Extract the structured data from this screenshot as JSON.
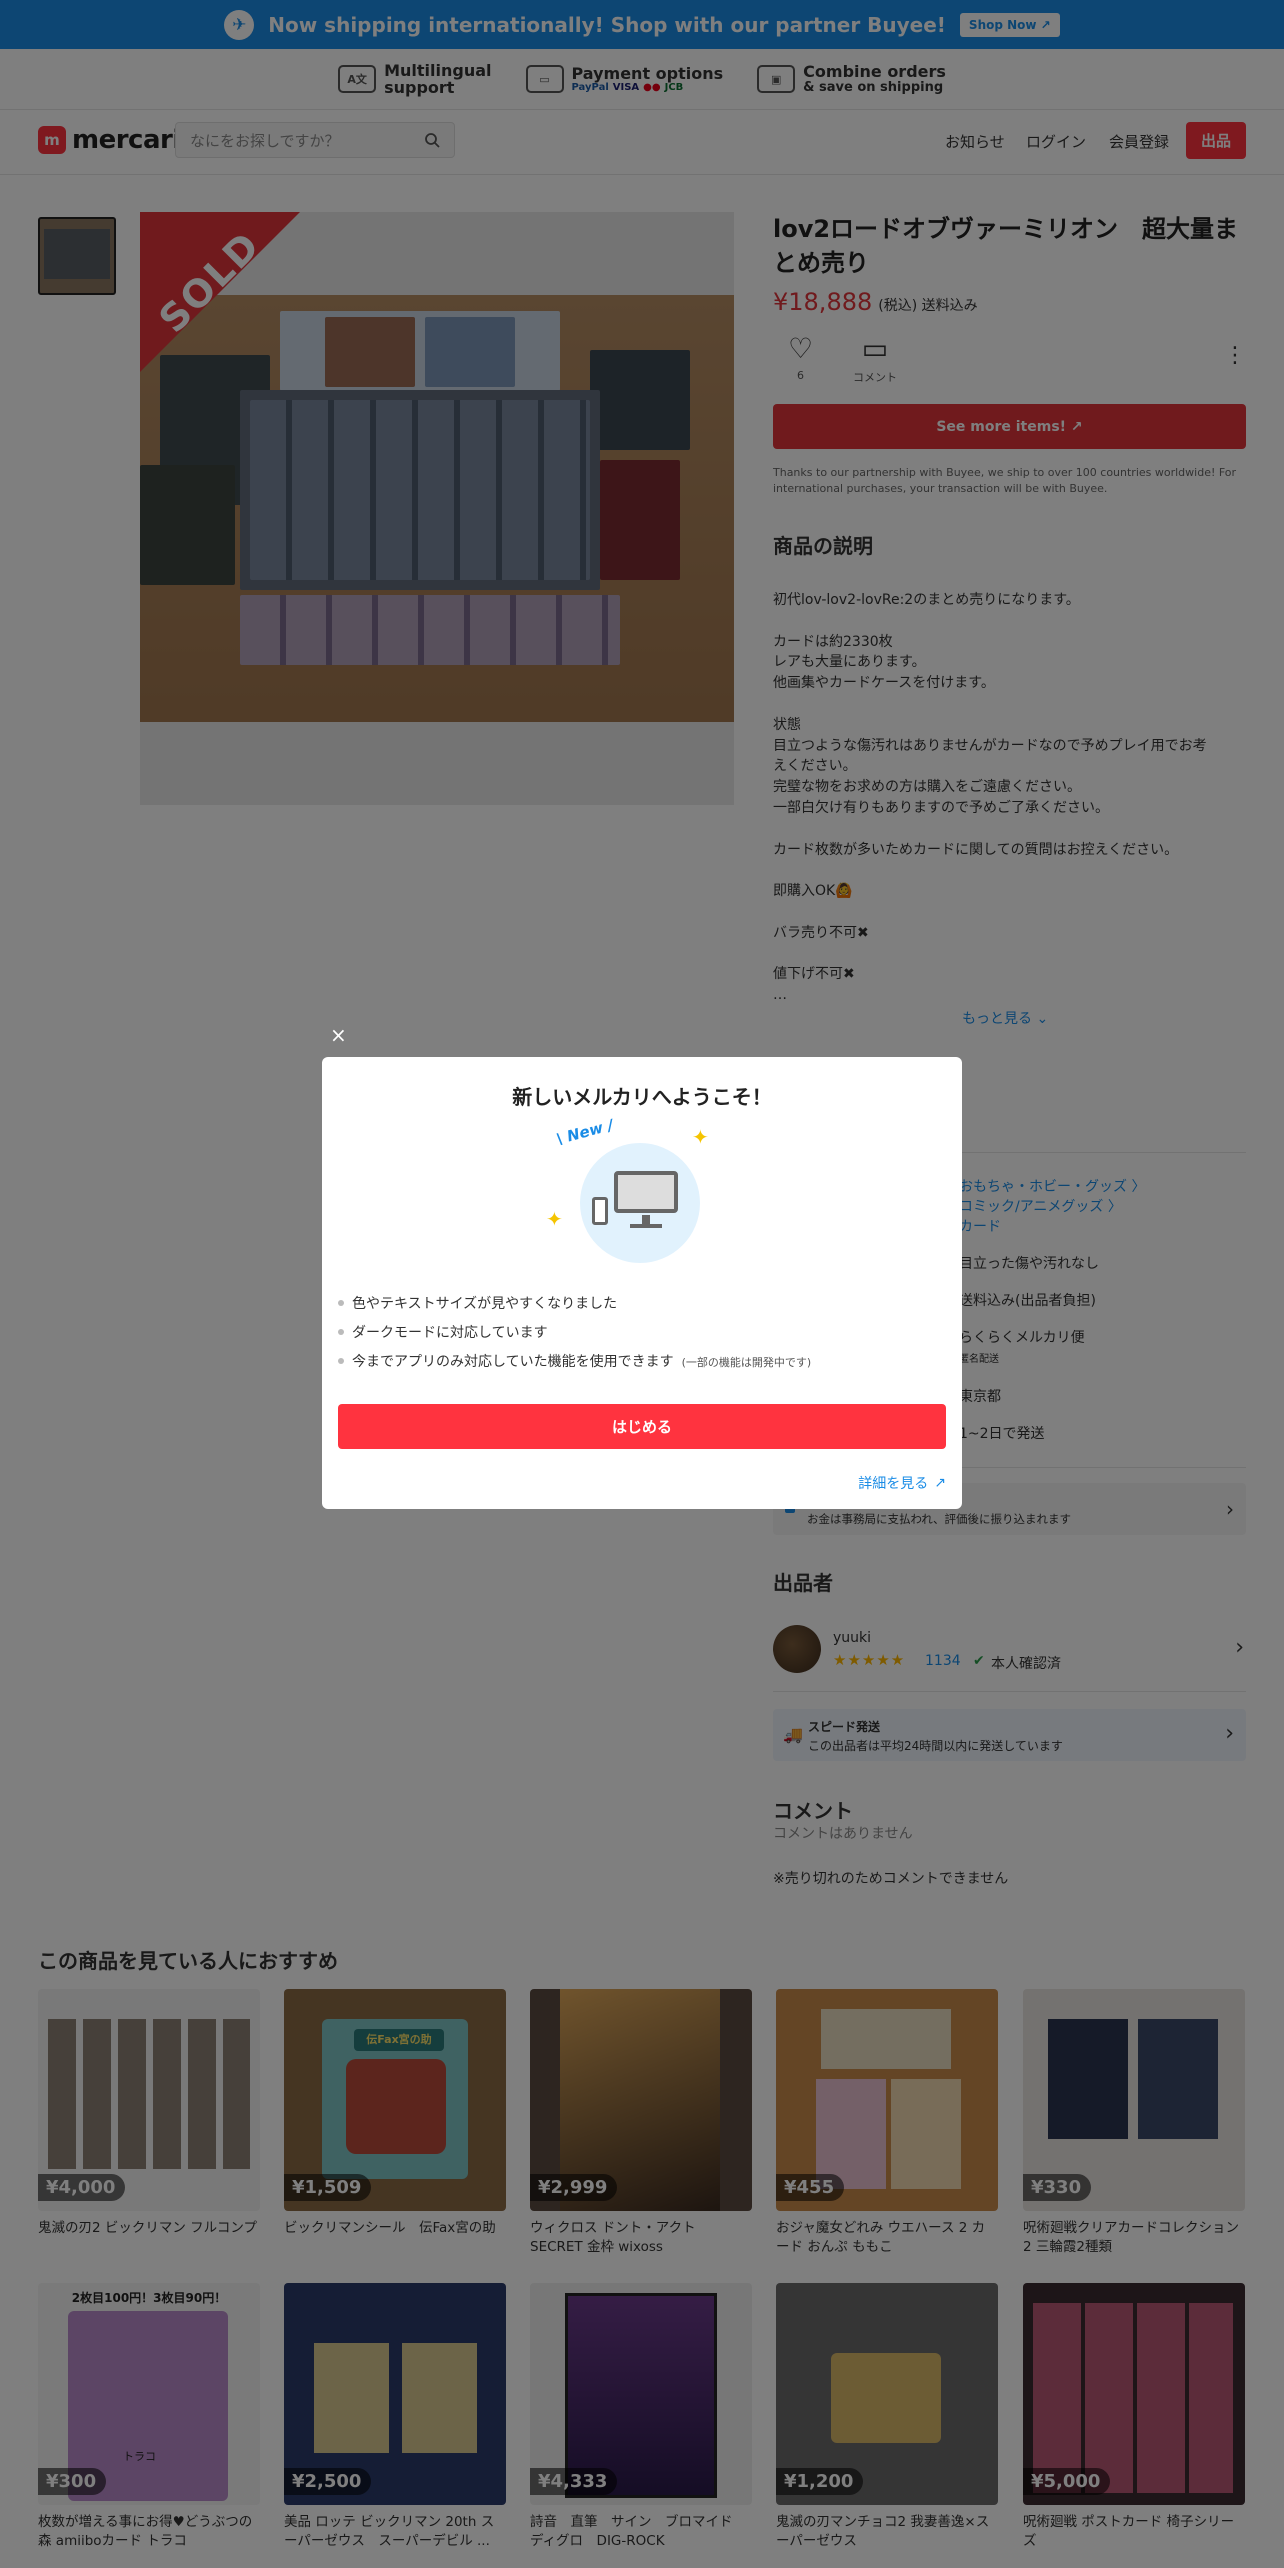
{
  "banner": {
    "text": "Now shipping internationally! Shop with our partner Buyee!",
    "button": "Shop Now",
    "icon": "airplane-icon"
  },
  "features": [
    {
      "title": "Multilingual",
      "subtitle": "support",
      "icon": "translate-icon",
      "icon_text": "A文"
    },
    {
      "title": "Payment options",
      "subtitle": "",
      "icon": "card-icon",
      "icon_text": "▭",
      "payments": [
        "PayPal",
        "VISA",
        "●●",
        "JCB"
      ]
    },
    {
      "title": "Combine orders",
      "subtitle": "& save on shipping",
      "icon": "box-icon",
      "icon_text": "▣"
    }
  ],
  "header": {
    "logo_text": "mercari",
    "logo_mark": "m",
    "search_placeholder": "なにをお探しですか？",
    "nav": {
      "news": "お知らせ",
      "login": "ログイン",
      "signup": "会員登録",
      "sell": "出品"
    }
  },
  "product": {
    "sold_label": "SOLD",
    "title": "lov2ロードオブヴァーミリオン　超大量まとめ売り",
    "price": "¥18,888",
    "price_note": "(税込) 送料込み",
    "likes_count": "6",
    "comment_label": "コメント",
    "see_more": "See more items!",
    "buyee_note": "Thanks to our partnership with Buyee, we ship to over 100 countries worldwide! For international purchases, your transaction will be with Buyee.",
    "desc_heading": "商品の説明",
    "desc_lines": [
      "初代lov-lov2-lovRe:2のまとめ売りになります。",
      "",
      "カードは約2330枚",
      "レアも大量にあります。",
      "他画集やカードケースを付けます。",
      "",
      "状態",
      "目立つような傷汚れはありませんがカードなので予めプレイ用でお考",
      "えください。",
      "完璧な物をお求めの方は購入をご遠慮ください。",
      "一部白欠け有りもありますので予めご了承ください。",
      "",
      "カード枚数が多いためカードに関しての質問はお控えください。",
      "",
      "即購入OK🙆",
      "",
      "バラ売り不可✖",
      "",
      "値下げ不可✖",
      "…"
    ],
    "more_link": "もっと見る"
  },
  "info_rows": [
    {
      "label": "",
      "value": "おもちゃ・ホビー・グッズ 〉",
      "link": true
    },
    {
      "label": "",
      "value": "コミック/アニメグッズ 〉",
      "link": true
    },
    {
      "label": "",
      "value": "カード",
      "link": true
    },
    {
      "label": "",
      "value": "目立った傷や汚れなし",
      "link": false
    },
    {
      "label": "",
      "value": "送料込み(出品者負担)",
      "link": false
    },
    {
      "label": "",
      "value": "らくらくメルカリ便",
      "link": false
    },
    {
      "label": "",
      "value": "匿名配送",
      "link": false
    },
    {
      "label": "",
      "value": "東京都",
      "link": false
    },
    {
      "label": "",
      "value": "1~2日で発送",
      "link": false
    }
  ],
  "payment_notice": "お金は事務局に支払われ、評価後に振り込まれます",
  "seller": {
    "heading": "出品者",
    "name": "yuuki",
    "stars": "★★★★★",
    "rating_count": "1134",
    "verified": "本人確認済"
  },
  "speed": {
    "title": "スピード発送",
    "text": "この出品者は平均24時間以内に発送しています"
  },
  "comments": {
    "heading": "コメント",
    "none": "コメントはありません",
    "closed": "※売り切れのためコメントできません"
  },
  "recommend": {
    "heading": "この商品を見ている人におすすめ",
    "items": [
      {
        "price": "¥4,000",
        "name": "鬼滅の刃2 ビックリマン フルコンプ"
      },
      {
        "price": "¥1,509",
        "name": "ビックリマンシール　伝Fax宮の助"
      },
      {
        "price": "¥2,999",
        "name": "ウィクロス ドント・アクト SECRET 金枠 wixoss"
      },
      {
        "price": "¥455",
        "name": "おジャ魔女どれみ ウエハース 2 カード おんぷ ももこ"
      },
      {
        "price": "¥330",
        "name": "呪術廻戦クリアカードコレクション2 三輪霞2種類"
      },
      {
        "price": "¥300",
        "name": "枚数が増える事にお得♥どうぶつの森 amiiboカード トラコ"
      },
      {
        "price": "¥2,500",
        "name": "美品 ロッテ ビックリマン 20th スーパーゼウス　スーパーデビル ..."
      },
      {
        "price": "¥4,333",
        "name": "詩音　直筆　サイン　ブロマイド　ディグロ　DIG-ROCK"
      },
      {
        "price": "¥1,200",
        "name": "鬼滅の刃マンチョコ2 我妻善逸×スーパーゼウス"
      },
      {
        "price": "¥5,000",
        "name": "呪術廻戦 ポストカード 椅子シリーズ"
      }
    ],
    "card_art": {
      "fax": "伝Fax宮の助",
      "promo": "2枚目100円！3枚目90円！",
      "name": "トラコ"
    }
  },
  "modal": {
    "title": "新しいメルカリへようこそ！",
    "badge": "New",
    "bullets": [
      {
        "text": "色やテキストサイズが見やすくなりました",
        "note": ""
      },
      {
        "text": "ダークモードに対応しています",
        "note": ""
      },
      {
        "text": "今までアプリのみ対応していた機能を使用できます",
        "note": "(一部の機能は開発中です)"
      }
    ],
    "start_button": "はじめる",
    "detail_link": "詳細を見る",
    "close": "×"
  },
  "colors": {
    "brand": "#ff333f",
    "buyee": "#1a8ce6",
    "sold": "#e0343b"
  }
}
